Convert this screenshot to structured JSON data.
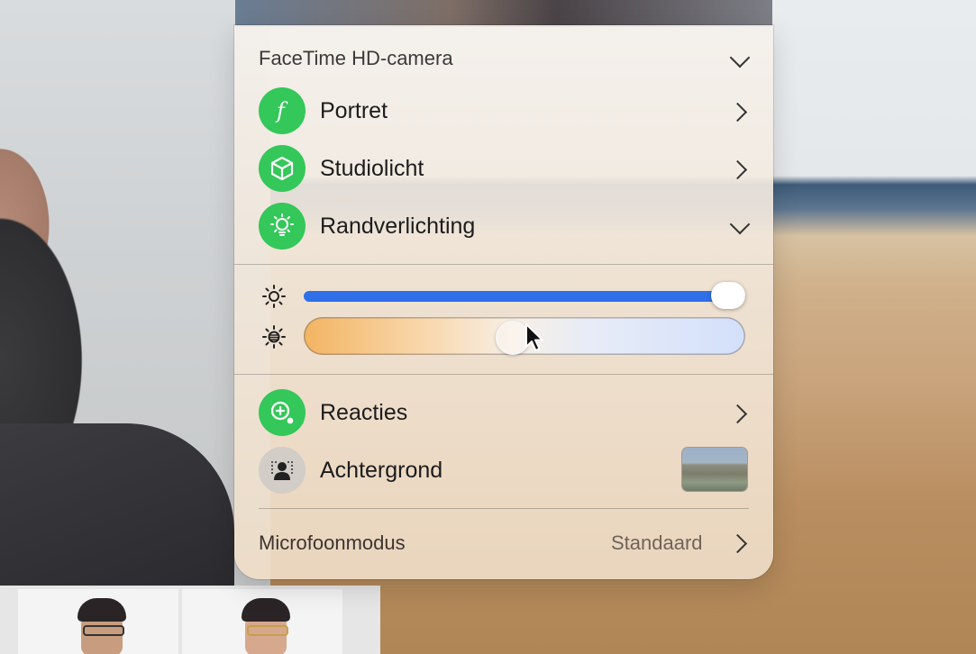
{
  "header": {
    "camera_title": "FaceTime HD-camera"
  },
  "effects": [
    {
      "label": "Portret",
      "icon": "portrait-f-icon"
    },
    {
      "label": "Studiolicht",
      "icon": "cube-icon"
    },
    {
      "label": "Randverlichting",
      "icon": "edge-light-icon"
    }
  ],
  "sliders": {
    "brightness": {
      "value": 1.0,
      "color": "#2f6fe8"
    },
    "temperature": {
      "value": 0.48
    }
  },
  "options": [
    {
      "label": "Reacties",
      "icon": "reactions-icon"
    },
    {
      "label": "Achtergrond",
      "icon": "background-person-icon"
    }
  ],
  "mic": {
    "label": "Microfoonmodus",
    "value": "Standaard"
  },
  "colors": {
    "accent_green": "#34c759",
    "slider_blue": "#2f6fe8"
  }
}
